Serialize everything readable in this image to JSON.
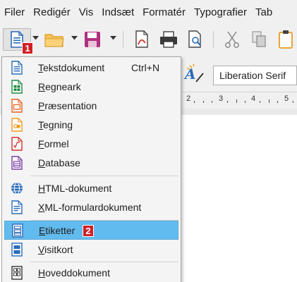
{
  "menubar": {
    "items": [
      "Filer",
      "Redigér",
      "Vis",
      "Indsæt",
      "Formatér",
      "Typografier",
      "Tab"
    ]
  },
  "badges": {
    "first": "1",
    "second": "2"
  },
  "toolbar": {
    "font_name": "Liberation Serif"
  },
  "ruler": {
    "numbers": [
      "2",
      "3",
      "4",
      "5"
    ]
  },
  "menu": {
    "items": [
      {
        "label_first": "T",
        "label_rest": "ekstdokument",
        "shortcut": "Ctrl+N",
        "icon": "writer-document-icon"
      },
      {
        "label_first": "R",
        "label_rest": "egneark",
        "shortcut": "",
        "icon": "spreadsheet-icon"
      },
      {
        "label_first": "P",
        "label_rest": "ræsentation",
        "shortcut": "",
        "icon": "presentation-icon"
      },
      {
        "label_first": "T",
        "label_rest": "egning",
        "shortcut": "",
        "icon": "drawing-icon"
      },
      {
        "label_first": "F",
        "label_rest": "ormel",
        "shortcut": "",
        "icon": "formula-icon"
      },
      {
        "label_first": "D",
        "label_rest": "atabase",
        "shortcut": "",
        "icon": "database-icon"
      },
      {
        "label_first": "H",
        "label_rest": "TML-dokument",
        "shortcut": "",
        "icon": "globe-icon"
      },
      {
        "label_first": "X",
        "label_rest": "ML-formulardokument",
        "shortcut": "",
        "icon": "xml-form-icon"
      },
      {
        "label_first": "E",
        "label_rest": "tiketter",
        "shortcut": "",
        "icon": "labels-icon",
        "selected": true
      },
      {
        "label_first": "V",
        "label_rest": "isitkort",
        "shortcut": "",
        "icon": "business-cards-icon"
      },
      {
        "label_first": "H",
        "label_rest": "oveddokument",
        "shortcut": "",
        "icon": "master-document-icon"
      }
    ]
  },
  "colors": {
    "selection": "#62bbee",
    "badge": "#d21f26",
    "writer_blue": "#2a6bb8",
    "calc_green": "#1e8a3e",
    "impress_orange": "#e8611f",
    "draw_orange": "#f39a1e",
    "math_red": "#d0312d",
    "base_purple": "#7a3ea3"
  }
}
